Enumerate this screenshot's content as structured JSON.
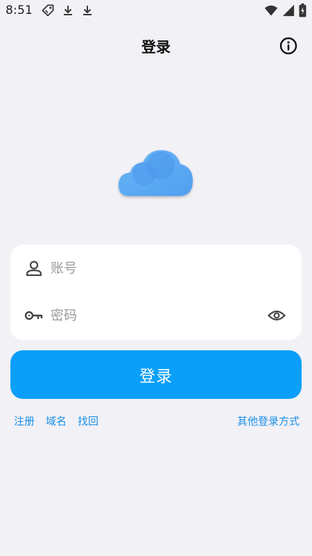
{
  "status_bar": {
    "time": "8:51",
    "left_icons": [
      "tag-icon",
      "download-icon",
      "download-icon"
    ],
    "right_icons": [
      "wifi-icon",
      "signal-icon",
      "battery-charging-icon"
    ]
  },
  "header": {
    "title": "登录",
    "info_icon": "info-icon"
  },
  "logo": {
    "icon": "cloud-icon"
  },
  "form": {
    "account": {
      "placeholder": "账号",
      "value": "",
      "icon": "user-icon"
    },
    "password": {
      "placeholder": "密码",
      "value": "",
      "icon": "key-icon",
      "toggle_icon": "eye-icon"
    }
  },
  "login_button": {
    "label": "登录"
  },
  "links": {
    "register": "注册",
    "domain": "域名",
    "recover": "找回",
    "other_login": "其他登录方式"
  },
  "colors": {
    "background": "#f2f1f6",
    "primary": "#0a9ff8",
    "link": "#1b8fe8",
    "card": "#ffffff",
    "cloud": "#5aaaf5"
  }
}
